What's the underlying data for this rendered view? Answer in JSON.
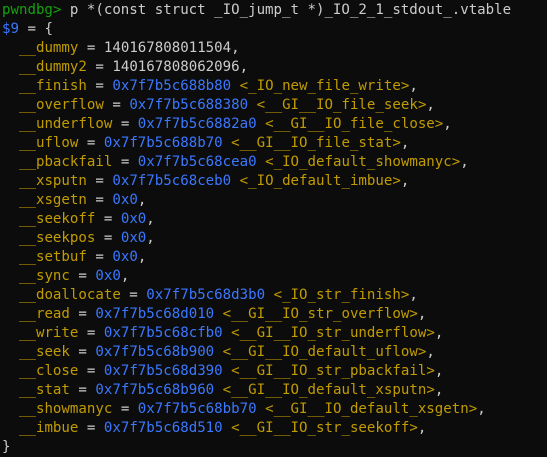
{
  "terminal": {
    "prompt": "pwndbg>",
    "command": " p *(const struct _IO_jump_t *)_IO_2_1_stdout_.vtable",
    "result_var": "$9",
    "open": " = {",
    "close": "}",
    "fields": [
      {
        "name": "__dummy",
        "value": "140167808011504",
        "kind": "num"
      },
      {
        "name": "__dummy2",
        "value": "140167808062096",
        "kind": "num"
      },
      {
        "name": "__finish",
        "value": "0x7f7b5c688b80",
        "symbol": "<_IO_new_file_write>",
        "kind": "ptr"
      },
      {
        "name": "__overflow",
        "value": "0x7f7b5c688380",
        "symbol": "<__GI__IO_file_seek>",
        "kind": "ptr"
      },
      {
        "name": "__underflow",
        "value": "0x7f7b5c6882a0",
        "symbol": "<__GI__IO_file_close>",
        "kind": "ptr"
      },
      {
        "name": "__uflow",
        "value": "0x7f7b5c688b70",
        "symbol": "<__GI__IO_file_stat>",
        "kind": "ptr"
      },
      {
        "name": "__pbackfail",
        "value": "0x7f7b5c68cea0",
        "symbol": "<_IO_default_showmanyc>",
        "kind": "ptr"
      },
      {
        "name": "__xsputn",
        "value": "0x7f7b5c68ceb0",
        "symbol": "<_IO_default_imbue>",
        "kind": "ptr"
      },
      {
        "name": "__xsgetn",
        "value": "0x0",
        "kind": "zero"
      },
      {
        "name": "__seekoff",
        "value": "0x0",
        "kind": "zero"
      },
      {
        "name": "__seekpos",
        "value": "0x0",
        "kind": "zero"
      },
      {
        "name": "__setbuf",
        "value": "0x0",
        "kind": "zero"
      },
      {
        "name": "__sync",
        "value": "0x0",
        "kind": "zero"
      },
      {
        "name": "__doallocate",
        "value": "0x7f7b5c68d3b0",
        "symbol": "<_IO_str_finish>",
        "kind": "ptr"
      },
      {
        "name": "__read",
        "value": "0x7f7b5c68d010",
        "symbol": "<__GI__IO_str_overflow>",
        "kind": "ptr"
      },
      {
        "name": "__write",
        "value": "0x7f7b5c68cfb0",
        "symbol": "<__GI__IO_str_underflow>",
        "kind": "ptr"
      },
      {
        "name": "__seek",
        "value": "0x7f7b5c68b900",
        "symbol": "<__GI__IO_default_uflow>",
        "kind": "ptr"
      },
      {
        "name": "__close",
        "value": "0x7f7b5c68d390",
        "symbol": "<__GI__IO_str_pbackfail>",
        "kind": "ptr"
      },
      {
        "name": "__stat",
        "value": "0x7f7b5c68b960",
        "symbol": "<__GI__IO_default_xsputn>",
        "kind": "ptr"
      },
      {
        "name": "__showmanyc",
        "value": "0x7f7b5c68bb70",
        "symbol": "<__GI__IO_default_xsgetn>",
        "kind": "ptr"
      },
      {
        "name": "__imbue",
        "value": "0x7f7b5c68d510",
        "symbol": "<__GI__IO_str_seekoff>",
        "kind": "ptr"
      }
    ]
  }
}
